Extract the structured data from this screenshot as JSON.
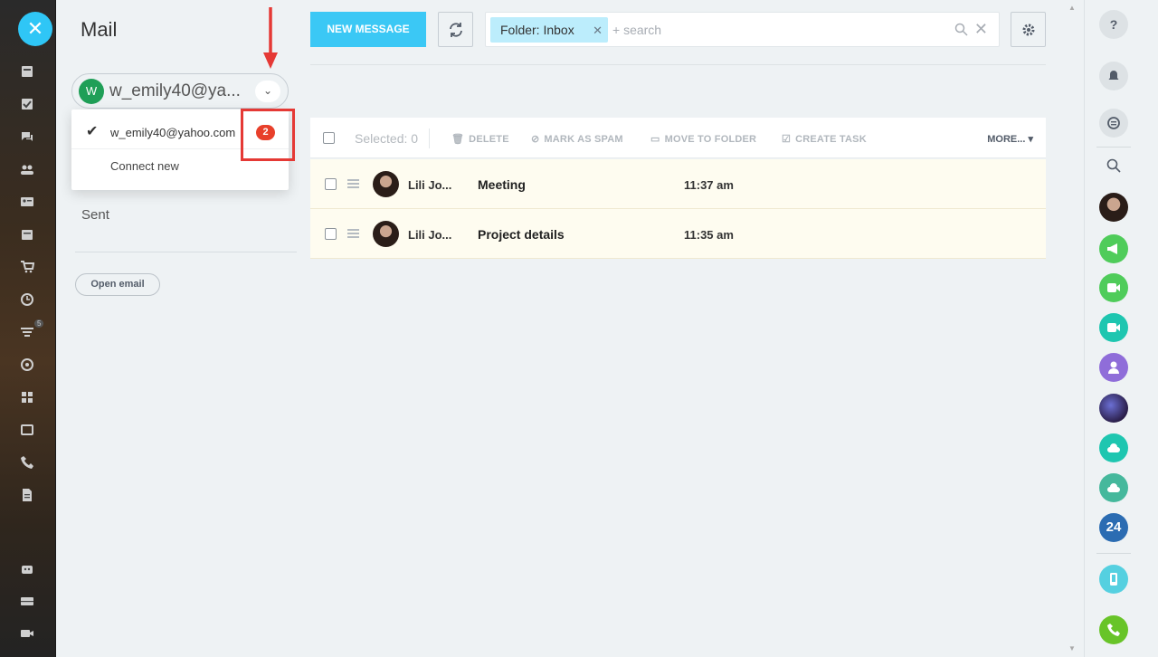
{
  "page": {
    "title": "Mail"
  },
  "account": {
    "avatar_letter": "W",
    "name_truncated": "w_emily40@ya...",
    "dropdown_items": [
      {
        "label": "w_emily40@yahoo.com",
        "checked": true,
        "badge": "2"
      },
      {
        "label": "Connect new"
      }
    ]
  },
  "folders": {
    "sent": "Sent"
  },
  "buttons": {
    "open_email": "Open email",
    "new_message": "NEW MESSAGE"
  },
  "search": {
    "filter_chip": "Folder: Inbox",
    "placeholder": "+ search"
  },
  "grid": {
    "selected_label": "Selected: 0",
    "actions": {
      "delete": "DELETE",
      "mark_spam": "MARK AS SPAM",
      "move_folder": "MOVE TO FOLDER",
      "create_task": "CREATE TASK",
      "more": "MORE..."
    },
    "rows": [
      {
        "sender": "Lili Jo...",
        "subject": "Meeting",
        "time": "11:37 am"
      },
      {
        "sender": "Lili Jo...",
        "subject": "Project details",
        "time": "11:35 am"
      }
    ]
  },
  "sidebar": {
    "filter_badge": "5"
  },
  "rightbar": {
    "b24_label": "24"
  },
  "colors": {
    "accent": "#3bc8f5",
    "badge": "#e8402b",
    "highlight": "#e53935",
    "avatar_green": "#1f9f57"
  }
}
